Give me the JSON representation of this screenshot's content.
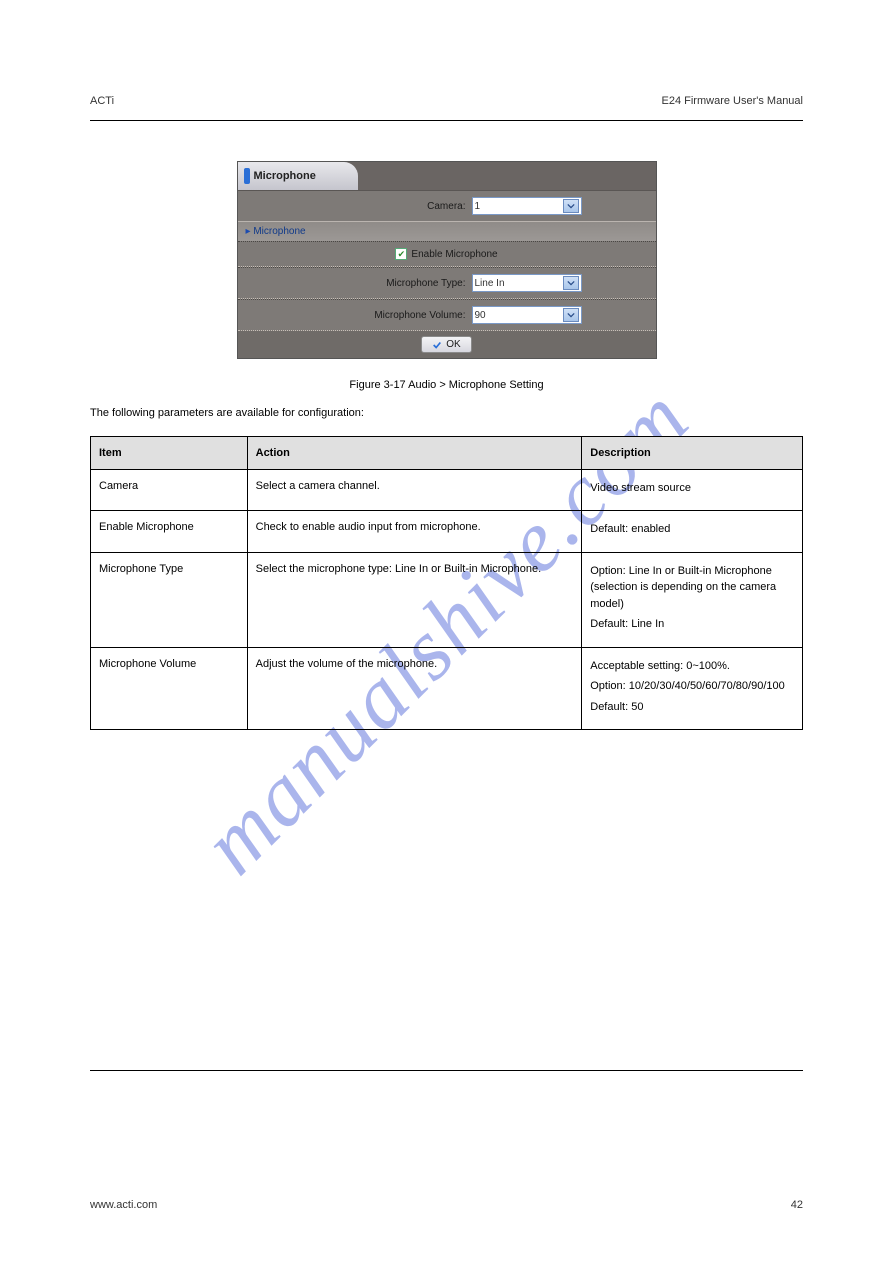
{
  "header": {
    "left": "ACTi",
    "right": "E24 Firmware User's Manual"
  },
  "footer": {
    "left": "www.acti.com",
    "right": "42"
  },
  "watermark": "manualshive.com",
  "panel": {
    "tab": "Microphone",
    "camera_label": "Camera:",
    "camera_value": "1",
    "section": "Microphone",
    "enable_label": "Enable Microphone",
    "enable_checked": true,
    "type_label": "Microphone Type:",
    "type_value": "Line In",
    "volume_label": "Microphone Volume:",
    "volume_value": "90",
    "ok_label": "OK"
  },
  "figure_caption": "Figure 3-17  Audio > Microphone Setting",
  "paragraph": "The following parameters are available for configuration:",
  "table": {
    "headers": [
      "Item",
      "Action",
      "Description"
    ],
    "rows": [
      {
        "item": "Camera",
        "action": "Select a camera channel.",
        "desc": [
          "Video stream source"
        ]
      },
      {
        "item": "Enable Microphone",
        "action": "Check to enable audio input from microphone.",
        "desc": [
          "Default: enabled"
        ]
      },
      {
        "item": "Microphone Type",
        "action": "Select the microphone type: Line In or Built-in Microphone.",
        "desc": [
          "Option: Line In or Built-in Microphone (selection is depending on the camera model)",
          "Default: Line In"
        ]
      },
      {
        "item": "Microphone Volume",
        "action": "Adjust the volume of the microphone.",
        "desc": [
          "Acceptable setting: 0~100%.",
          "Option: 10/20/30/40/50/60/70/80/90/100",
          "Default: 50"
        ]
      }
    ]
  }
}
